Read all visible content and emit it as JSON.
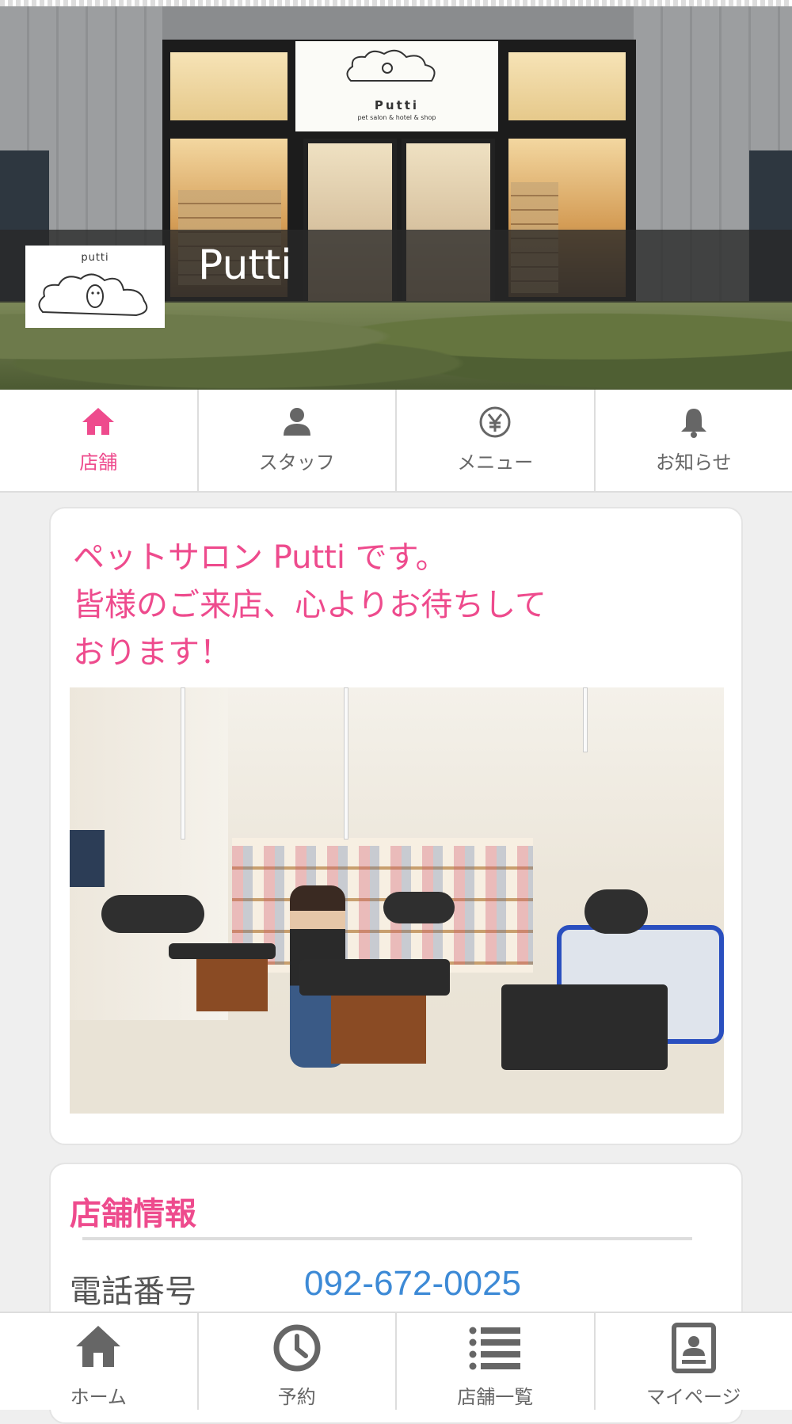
{
  "shop": {
    "name": "Putti",
    "logo_text": "putti"
  },
  "storefront_sign": {
    "title": "Putti",
    "subtitle": "pet salon & hotel & shop"
  },
  "tabs": [
    {
      "label": "店舗",
      "icon": "home-icon",
      "active": true
    },
    {
      "label": "スタッフ",
      "icon": "person-icon",
      "active": false
    },
    {
      "label": "メニュー",
      "icon": "yen-icon",
      "active": false
    },
    {
      "label": "お知らせ",
      "icon": "bell-icon",
      "active": false
    }
  ],
  "intro": {
    "text": "ペットサロン Putti です。\n皆様のご来店、心よりお待ちして\nおります！"
  },
  "store_info": {
    "title": "店舗情報",
    "phone_label": "電話番号",
    "phone_value": "092-672-0025"
  },
  "bottom_nav": [
    {
      "label": "ホーム",
      "icon": "home-icon"
    },
    {
      "label": "予約",
      "icon": "clock-icon"
    },
    {
      "label": "店舗一覧",
      "icon": "list-icon"
    },
    {
      "label": "マイページ",
      "icon": "profile-card-icon"
    }
  ],
  "colors": {
    "accent": "#ee4b8d",
    "link": "#3d8ad6",
    "icon_gray": "#666666"
  }
}
